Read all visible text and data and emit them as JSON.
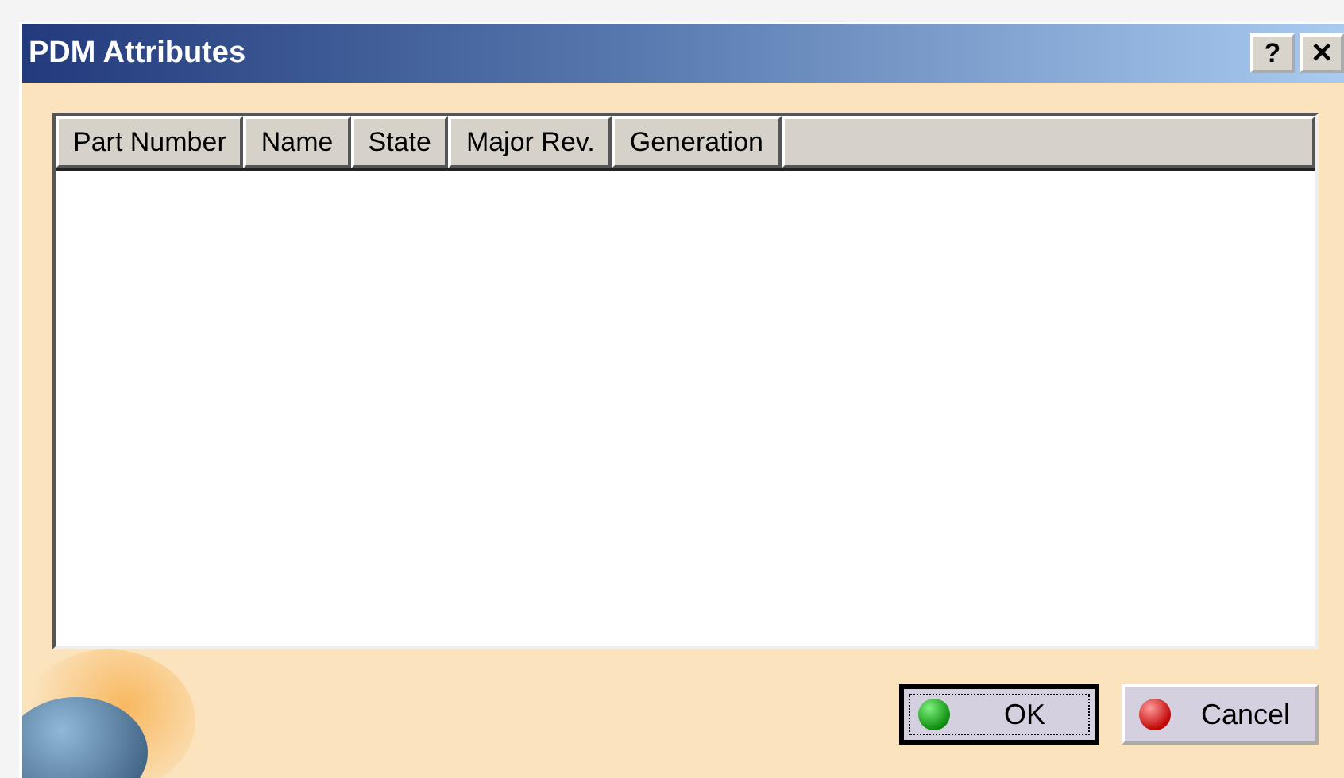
{
  "window": {
    "title": "PDM Attributes",
    "controls": [
      "?",
      "✕"
    ]
  },
  "table": {
    "columns": [
      "Part Number",
      "Name",
      "State",
      "Major Rev.",
      "Generation"
    ]
  },
  "buttons": [
    {
      "label": "OK",
      "kind": "ok",
      "default": true
    },
    {
      "label": "Cancel",
      "kind": "cancel",
      "default": false
    }
  ]
}
